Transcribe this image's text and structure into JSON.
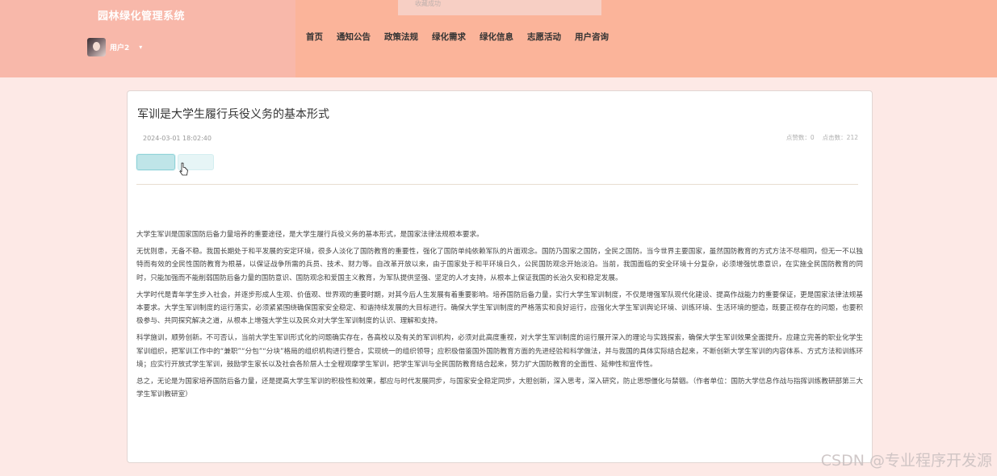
{
  "header": {
    "site_title": "园林绿化管理系统",
    "user_name": "用户2",
    "caret": "▾"
  },
  "toast": {
    "text": "收藏成功"
  },
  "nav": {
    "items": [
      "首页",
      "通知公告",
      "政策法规",
      "绿化需求",
      "绿化信息",
      "志愿活动",
      "用户咨询"
    ]
  },
  "article": {
    "title": "军训是大学生履行兵役义务的基本形式",
    "date": "2024-03-01 18:02:40",
    "likes_text": "点赞数：0",
    "clicks_text": "点击数：212",
    "paragraphs": [
      "大学生军训是国家国防后备力量培养的重要途径，是大学生履行兵役义务的基本形式，是国家法律法规根本要求。",
      "无忧则患，无备不稳。我国长期处于和平发展的安定环境，很多人淡化了国防教育的重要性，强化了国防单纯依赖军队的片面观念。国防乃国家之国防，全民之国防。当今世界主要国家，虽然国防教育的方式方法不尽相同，但无一不以独特而有效的全民性国防教育为根基，以保证战争所需的兵员、技术、财力等。自改革开放以来，由于国家处于和平环境日久，公民国防观念开始淡泊。当前，我国面临的安全环境十分复杂，必须增强忧患意识，在实施全民国防教育的同时，只能加强而不能削弱国防后备力量的国防意识、国防观念和爱国主义教育，为军队提供坚强、坚定的人才支持，从根本上保证我国的长治久安和稳定发展。",
      "大学时代是青年学生步入社会，并逐步形成人生观、价值观、世界观的重要时期，对其今后人生发展有着重要影响。培养国防后备力量，实行大学生军训制度，不仅是增强军队现代化建设、提高作战能力的重要保证，更是国家法律法规基本要求。大学生军训制度的运行落实，必须紧紧围绕确保国家安全稳定、和谐持续发展的大目标进行。确保大学生军训制度的严格落实和良好运行，应强化大学生军训舆论环境、训练环境、生活环境的塑造，既要正视存在的问题，也要积极参与、共同探究解决之道，从根本上增强大学生以及民众对大学生军训制度的认识、理解和支持。",
      "科学施训，顺势创新。不可否认，当前大学生军训形式化的问题确实存在，各高校以及有关的军训机构，必须对此高度重视，对大学生军训制度的运行展开深入的理论与实践探索，确保大学生军训效果全面提升。应建立完善的职业化学生军训组织，把军训工作中的“兼职”“分包”“分块”格局的组织机构进行整合，实现统一的组织领导；应积极借鉴国外国防教育方面的先进经验和科学做法，并与我国的具体实际结合起来，不断创新大学生军训的内容体系、方式方法和训练环境；应实行开放式学生军训，鼓励学生家长以及社会各阶层人士全程观摩学生军训，把学生军训与全民国防教育结合起来，努力扩大国防教育的全面性、延伸性和宣传性。",
      "总之，无论是为国家培养国防后备力量，还是提高大学生军训的积极性和效果，都应与时代发展同步，与国家安全稳定同步，大胆创新，深入思考，深入研究，防止思想僵化与禁锢。（作者单位：国防大学信息作战与指挥训练教研部第三大学生军训教研室）"
    ]
  },
  "watermark": {
    "text": "CSDN @专业程序开发源"
  },
  "colors": {
    "header_bg": "#fbb49a",
    "header_left_bg": "#f8b8aa",
    "page_bg": "#fde9e6",
    "button_primary": "#bfe5e8"
  },
  "icons": [
    "caret-down-icon",
    "mouse-cursor-icon",
    "avatar-image"
  ]
}
